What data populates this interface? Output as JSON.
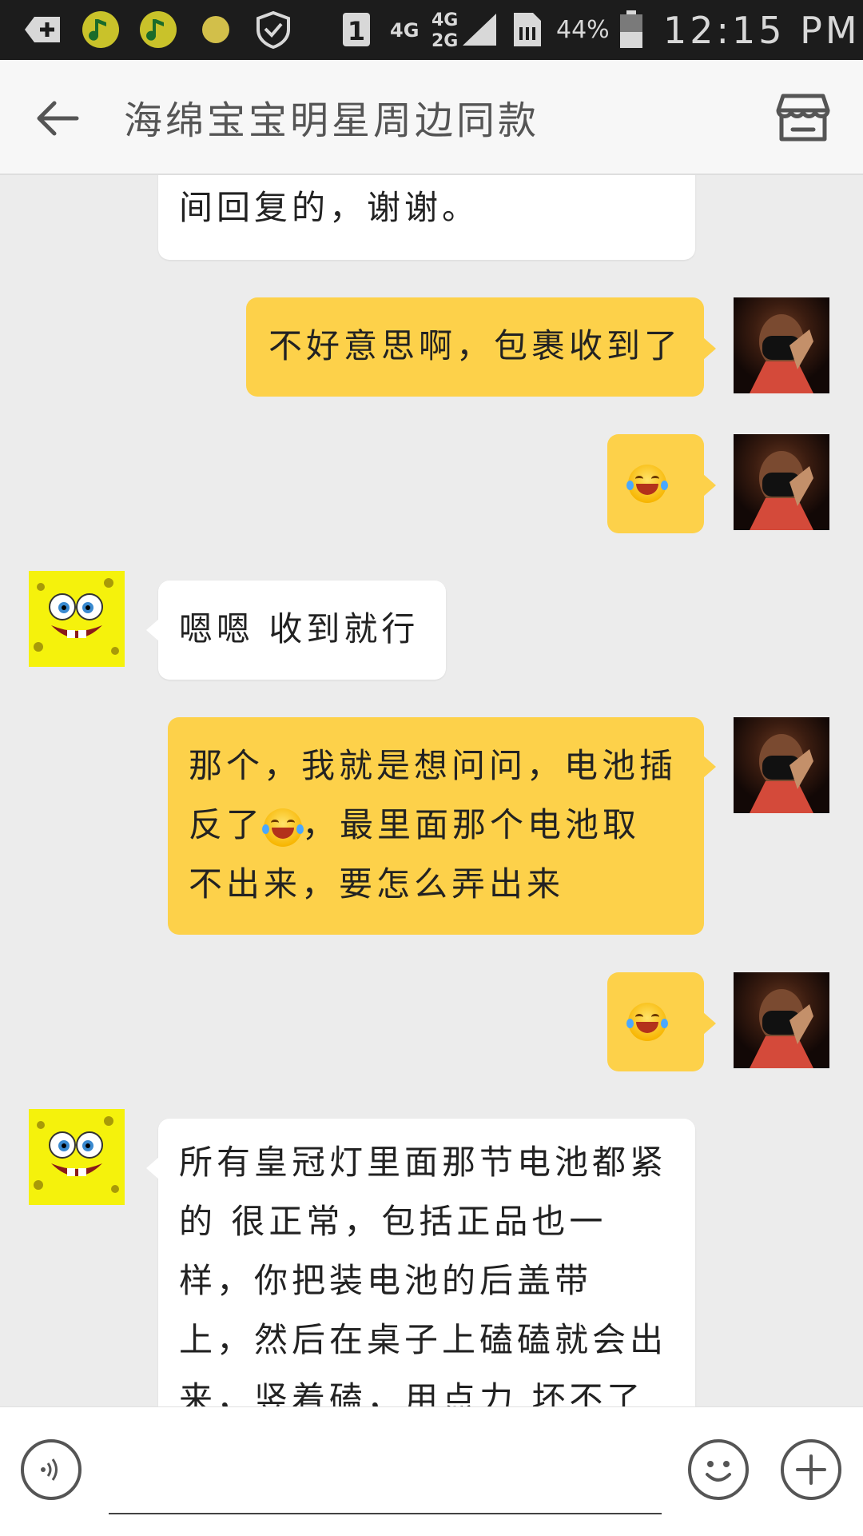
{
  "status_bar": {
    "sim_label": "1",
    "net_top": "4G",
    "net_mid": "4G",
    "net_bottom": "2G",
    "battery": "44%",
    "time": "12:15 PM"
  },
  "header": {
    "title": "海绵宝宝明星周边同款"
  },
  "messages": [
    {
      "side": "in",
      "text": "间回复的，谢谢。",
      "cut_top": true
    },
    {
      "side": "out",
      "text": "不好意思啊，包裹收到了"
    },
    {
      "side": "out",
      "emoji": "tears-of-joy"
    },
    {
      "side": "in",
      "text": "嗯嗯 收到就行"
    },
    {
      "side": "out",
      "line1": "那个，我就是想问问，电池插",
      "line2_a": "反了",
      "line2_b": "，最里面那个电池取",
      "line3": "不出来，要怎么弄出来",
      "emoji": "tears-of-joy"
    },
    {
      "side": "out",
      "emoji": "tears-of-joy"
    },
    {
      "side": "in",
      "text": "所有皇冠灯里面那节电池都紧\n的 很正常，包括正品也一\n样，你把装电池的后盖带\n上，然后在桌子上磕磕就会出\n来，竖着磕，用点力 坏不了"
    }
  ],
  "colors": {
    "outgoing_bubble": "#fdd14a",
    "incoming_bubble": "#ffffff",
    "background": "#ececec"
  },
  "icons": {
    "back": "arrow-left-icon",
    "store": "store-icon",
    "voice": "voice-icon",
    "emoji": "smiley-icon",
    "plus": "plus-icon"
  }
}
